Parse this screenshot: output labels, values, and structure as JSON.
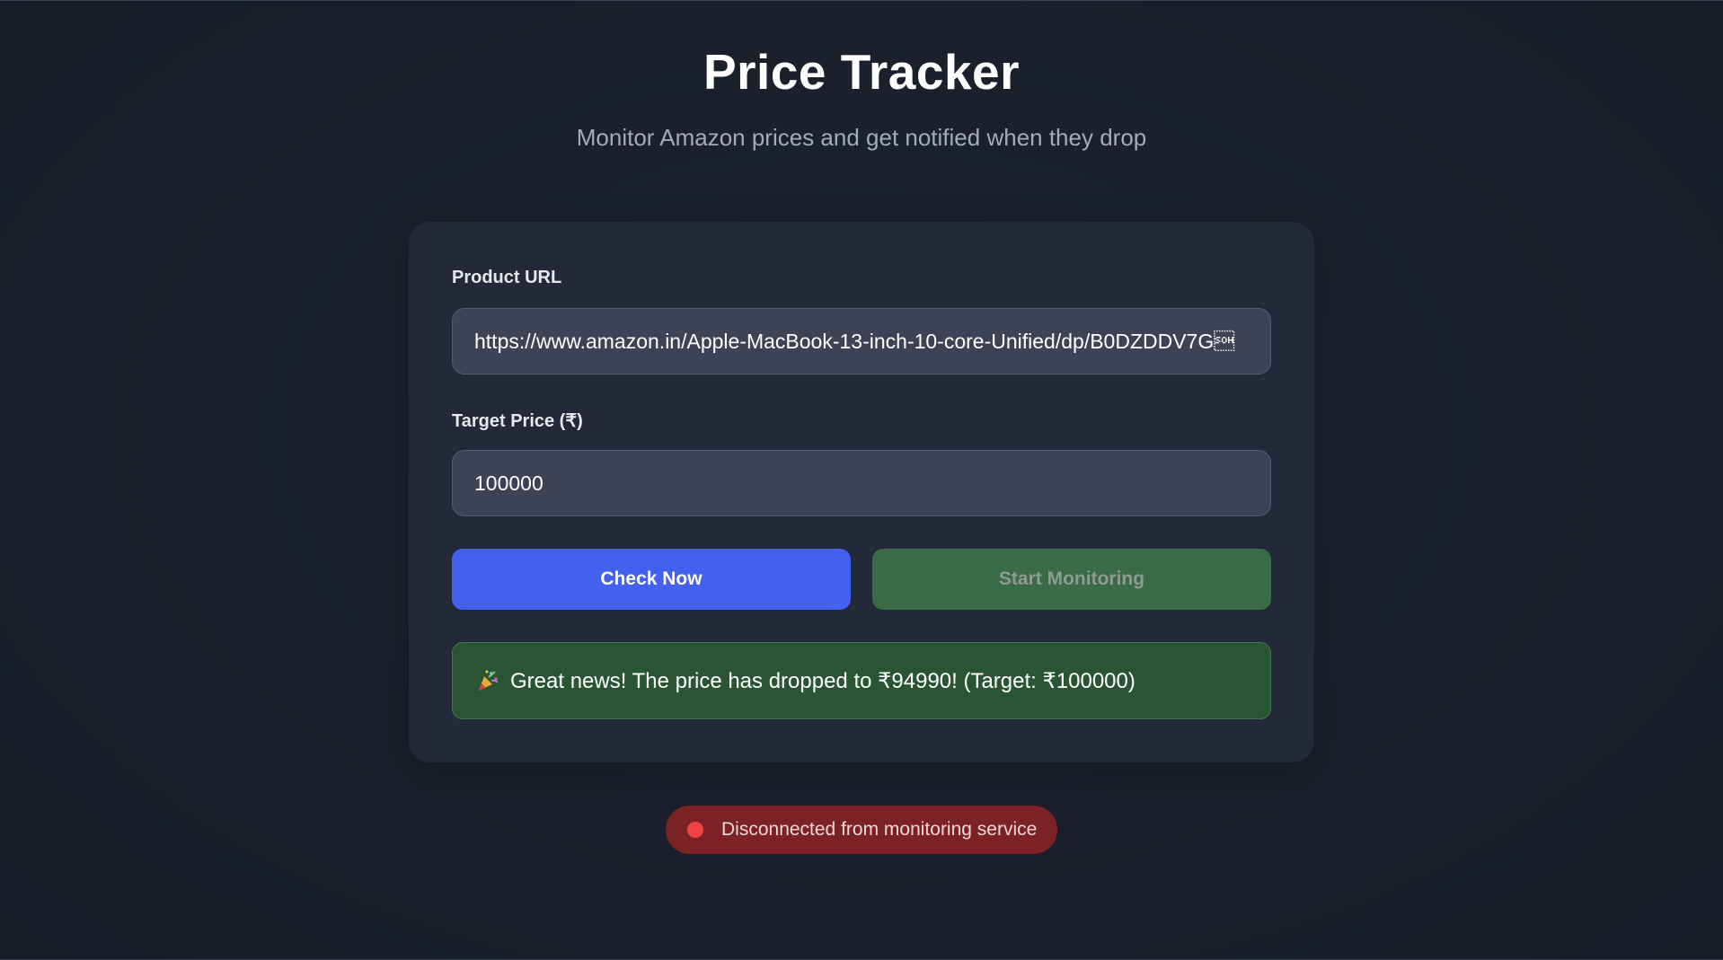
{
  "header": {
    "title": "Price Tracker",
    "subtitle": "Monitor Amazon prices and get notified when they drop"
  },
  "form": {
    "url_label": "Product URL",
    "url_value": "https://www.amazon.in/Apple-MacBook-13-inch-10-core-Unified/dp/B0DZDDV7G\u0001",
    "price_label": "Target Price (₹)",
    "price_value": "100000"
  },
  "actions": {
    "check_label": "Check Now",
    "monitor_label": "Start Monitoring"
  },
  "result": {
    "icon": "party-popper-icon",
    "message": "Great news! The price has dropped to ₹94990! (Target: ₹100000)"
  },
  "status": {
    "text": "Disconnected from monitoring service",
    "dot_color": "#ef4444"
  },
  "colors": {
    "accent": "#4361ee",
    "success_bg": "#2a5535",
    "monitor_bg": "#3a6b47",
    "error_bg": "#7b2224"
  }
}
